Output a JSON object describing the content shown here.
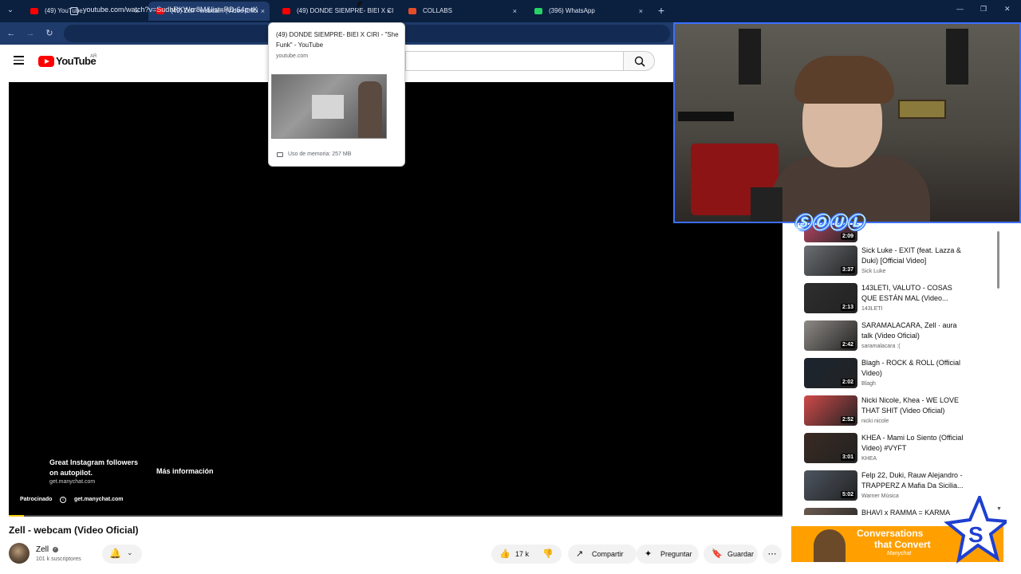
{
  "browser": {
    "tabs": [
      {
        "label": "(49) YouTube",
        "favicon": "youtube-icon",
        "active": false
      },
      {
        "label": "(49) Zell - webcam (Video Ofici",
        "favicon": "youtube-icon",
        "active": true
      },
      {
        "label": "(49) DONDE SIEMPRE- BIEI X CI",
        "favicon": "youtube-icon",
        "active": false
      },
      {
        "label": "COLLABS",
        "favicon": "collabs-icon",
        "active": false
      },
      {
        "label": "(396) WhatsApp",
        "favicon": "whatsapp-icon",
        "active": false
      }
    ],
    "close_glyph": "×",
    "new_tab_glyph": "+",
    "url": "youtube.com/watch?v=SudhRKWcr8M&list=RD-64p-tK",
    "colors": {
      "tabstrip": "#0b1f3f",
      "toolbar": "#1f3b6b"
    }
  },
  "hover_card": {
    "title": "(49) DONDE SIEMPRE- BIEI X CIRI - \"She Funk\" - YouTube",
    "domain": "youtube.com",
    "memory": "Uso de memoria: 257 MB"
  },
  "youtube": {
    "logo_text": "YouTube",
    "country": "AR"
  },
  "player": {
    "ad": {
      "headline": "Great Instagram followers on autopilot.",
      "domain": "get.manychat.com",
      "cta": "Más información",
      "sponsored": "Patrocinado",
      "info_glyph": "i",
      "domain_footer": "get.manychat.com",
      "progress": 0.02
    }
  },
  "video": {
    "title": "Zell - webcam (Video Oficial)",
    "channel": "Zell",
    "subscribers": "101 k suscriptores",
    "likes": "17 k",
    "share_label": "Compartir",
    "ask_label": "Preguntar",
    "save_label": "Guardar"
  },
  "sidebar": {
    "items": [
      {
        "title": "",
        "channel": "",
        "duration": "2:09",
        "thumb": "#c44a6a"
      },
      {
        "title": "Sick Luke - EXIT (feat. Lazza & Duki) [Official Video]",
        "channel": "Sick Luke",
        "duration": "3:37",
        "thumb": "#6b6f73"
      },
      {
        "title": "143LETI, VALUTO - COSAS QUE ESTÁN MAL (Video...",
        "channel": "143LETI",
        "duration": "2:13",
        "thumb": "#2e2e2e"
      },
      {
        "title": "SARAMALACARA, Zell · aura talk (Video Oficial)",
        "channel": "saramalacara :(",
        "duration": "2:42",
        "thumb": "#8e8a86"
      },
      {
        "title": "Blagh - ROCK & ROLL (Official Video)",
        "channel": "Blagh",
        "duration": "2:02",
        "thumb": "#1c2530"
      },
      {
        "title": "Nicki Nicole, Khea - WE LOVE THAT SHIT (Video Oficial)",
        "channel": "nicki nicole",
        "duration": "2:52",
        "thumb": "#d04a4a"
      },
      {
        "title": "KHEA - Mami Lo Siento (Official Video) #VYFT",
        "channel": "KHEA",
        "duration": "3:01",
        "thumb": "#3a2a22"
      },
      {
        "title": "Felp 22, Duki, Rauw Alejandro - TRAPPERZ A Mafia Da Sicilia...",
        "channel": "Warner Música",
        "duration": "5:02",
        "thumb": "#4d5560"
      },
      {
        "title": "BHAVI x RAMMA = KARMA",
        "channel": "",
        "duration": "",
        "thumb": "#6a5a50"
      }
    ]
  },
  "banner": {
    "line1": "Conversations",
    "line2": "that Convert",
    "brand": "Manychat"
  }
}
